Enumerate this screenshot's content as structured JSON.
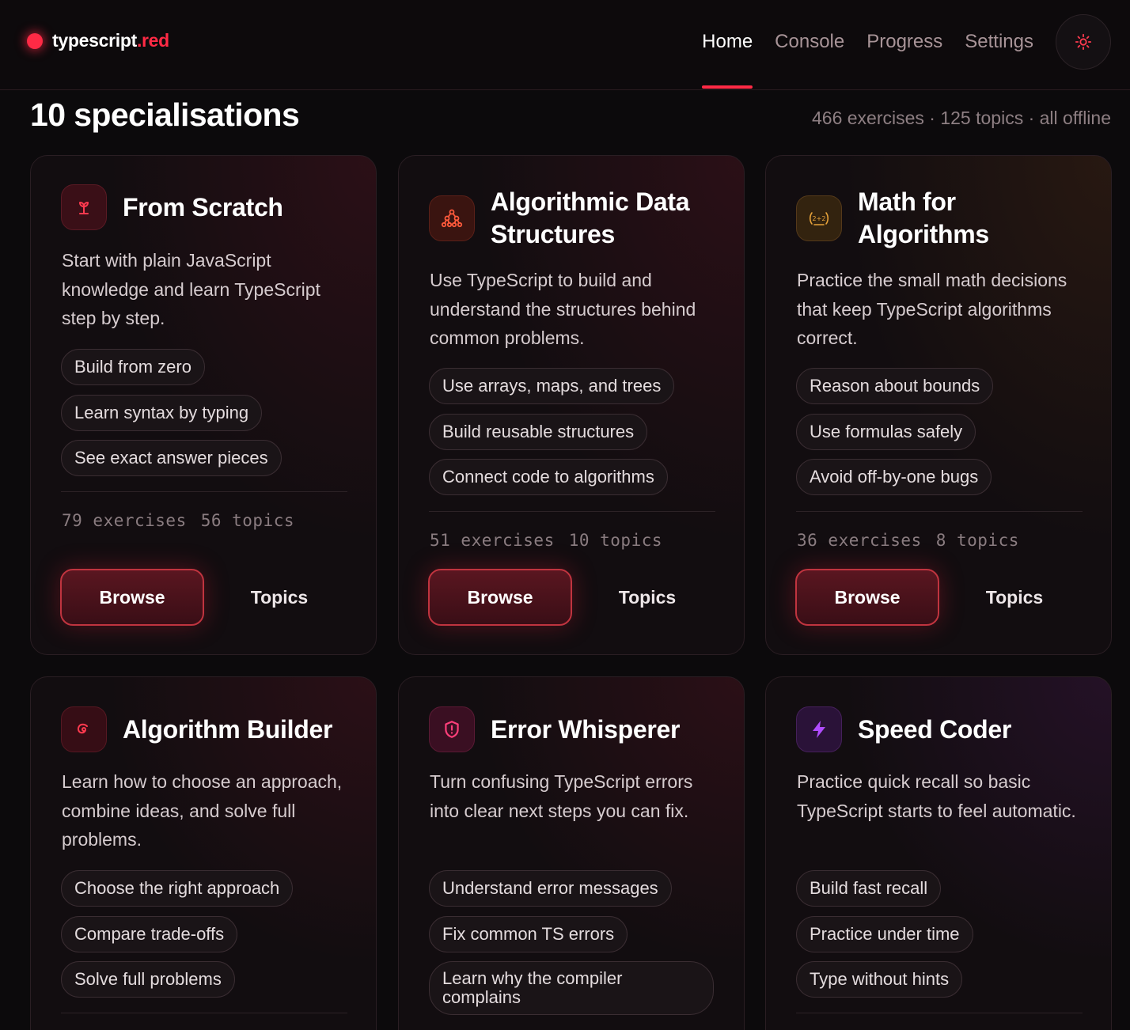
{
  "brand": {
    "name": "typescript",
    "tld": ".red"
  },
  "nav": {
    "items": [
      "Home",
      "Console",
      "Progress",
      "Settings"
    ],
    "active": "Home"
  },
  "theme_toggle_icon": "sun-icon",
  "page": {
    "title": "10 specialisations",
    "stats": "466 exercises · 125 topics · all offline"
  },
  "cards": [
    {
      "title": "From Scratch",
      "icon": "sprout-icon",
      "accent": "#ff3a4f",
      "description": "Start with plain JavaScript knowledge and learn TypeScript step by step.",
      "chips": [
        "Build from zero",
        "Learn syntax by typing",
        "See exact answer pieces"
      ],
      "exercises": "79 exercises",
      "topics": "56 topics",
      "browse_label": "Browse",
      "topics_label": "Topics"
    },
    {
      "title": "Algorithmic Data Structures",
      "icon": "tree-nodes-icon",
      "accent": "#ff5a3c",
      "description": "Use TypeScript to build and understand the structures behind common problems.",
      "chips": [
        "Use arrays, maps, and trees",
        "Build reusable structures",
        "Connect code to algorithms"
      ],
      "exercises": "51 exercises",
      "topics": "10 topics",
      "browse_label": "Browse",
      "topics_label": "Topics"
    },
    {
      "title": "Math for Algorithms",
      "icon": "calculator-laurel-icon",
      "accent": "#e8a33a",
      "description": "Practice the small math decisions that keep TypeScript algorithms correct.",
      "chips": [
        "Reason about bounds",
        "Use formulas safely",
        "Avoid off-by-one bugs"
      ],
      "exercises": "36 exercises",
      "topics": "8 topics",
      "browse_label": "Browse",
      "topics_label": "Topics"
    },
    {
      "title": "Algorithm Builder",
      "icon": "spiral-icon",
      "accent": "#ff3a4f",
      "description": "Learn how to choose an approach, combine ideas, and solve full problems.",
      "chips": [
        "Choose the right approach",
        "Compare trade-offs",
        "Solve full problems"
      ]
    },
    {
      "title": "Error Whisperer",
      "icon": "shield-alert-icon",
      "accent": "#ff3f7a",
      "description": "Turn confusing TypeScript errors into clear next steps you can fix.",
      "chips": [
        "Understand error messages",
        "Fix common TS errors",
        "Learn why the compiler complains"
      ]
    },
    {
      "title": "Speed Coder",
      "icon": "lightning-icon",
      "accent": "#b04cff",
      "description": "Practice quick recall so basic TypeScript starts to feel automatic.",
      "chips": [
        "Build fast recall",
        "Practice under time",
        "Type without hints"
      ]
    }
  ]
}
